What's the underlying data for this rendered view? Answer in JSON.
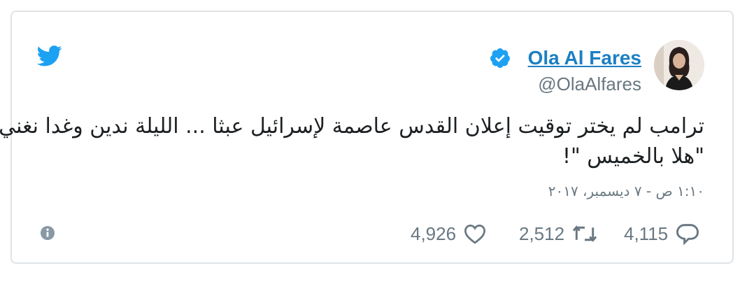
{
  "author": {
    "name": "Ola Al Fares",
    "handle": "@OlaAlfares",
    "verified": true
  },
  "tweet": {
    "text_line_1": "ترامب لم يختر توقيت إعلان القدس عاصمة لإسرائيل عبثا ... الليلة ندين وغدا نغني",
    "text_line_2": "\"هلا بالخميس \"!",
    "timestamp": "١:١٠ ص - ٧ ديسمبر، ٢٠١٧"
  },
  "actions": {
    "replies": "4,115",
    "retweets": "2,512",
    "likes": "4,926"
  },
  "icons": {
    "twitter": "twitter-bird-icon",
    "verified": "verified-badge-icon",
    "reply": "reply-icon",
    "retweet": "retweet-icon",
    "like": "heart-icon",
    "info": "info-icon"
  },
  "colors": {
    "link": "#1c7fc3",
    "twitter_blue": "#1da1f2",
    "text": "#1c2022",
    "muted": "#697882",
    "border": "#dfe3e7"
  }
}
